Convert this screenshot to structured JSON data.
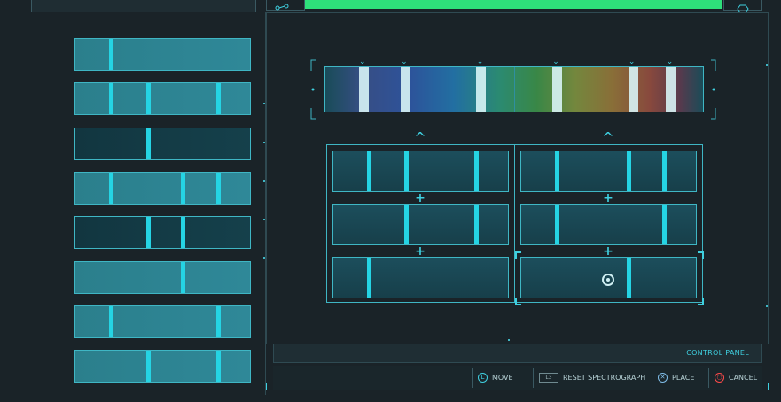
{
  "control_panel": {
    "label": "CONTROL PANEL"
  },
  "hints": [
    {
      "button": "L",
      "label": "MOVE"
    },
    {
      "button": "L3",
      "label": "RESET SPECTROGRAPH"
    },
    {
      "button": "✕",
      "label": "PLACE"
    },
    {
      "button": "○",
      "label": "CANCEL"
    }
  ],
  "palette_pieces": [
    {
      "style": "light",
      "lines": [
        0.2
      ]
    },
    {
      "style": "light",
      "lines": [
        0.2,
        0.41,
        0.81
      ]
    },
    {
      "style": "dark",
      "lines": [
        0.41
      ]
    },
    {
      "style": "light",
      "lines": [
        0.2,
        0.61,
        0.81
      ]
    },
    {
      "style": "dark",
      "lines": [
        0.41,
        0.61
      ]
    },
    {
      "style": "light",
      "lines": [
        0.61
      ]
    },
    {
      "style": "light",
      "lines": [
        0.2,
        0.81
      ]
    },
    {
      "style": "light",
      "lines": [
        0.41,
        0.81
      ]
    }
  ],
  "spectrum": {
    "lines": [
      0.1,
      0.21,
      0.41,
      0.61,
      0.81,
      0.91
    ]
  },
  "grid": {
    "left_column": [
      {
        "lines": [
          0.2,
          0.41,
          0.81
        ]
      },
      {
        "lines": [
          0.41,
          0.81
        ]
      },
      {
        "lines": [
          0.2
        ]
      }
    ],
    "right_column": [
      {
        "lines": [
          0.2,
          0.61,
          0.81
        ]
      },
      {
        "lines": [
          0.2,
          0.81
        ]
      },
      {
        "lines": [
          0.61
        ]
      }
    ]
  },
  "colors": {
    "accent": "#25d4e4",
    "progress": "#2ee07a",
    "panel_light": "#2b7f8c",
    "panel_dark": "#123640",
    "background": "#1a2328"
  }
}
